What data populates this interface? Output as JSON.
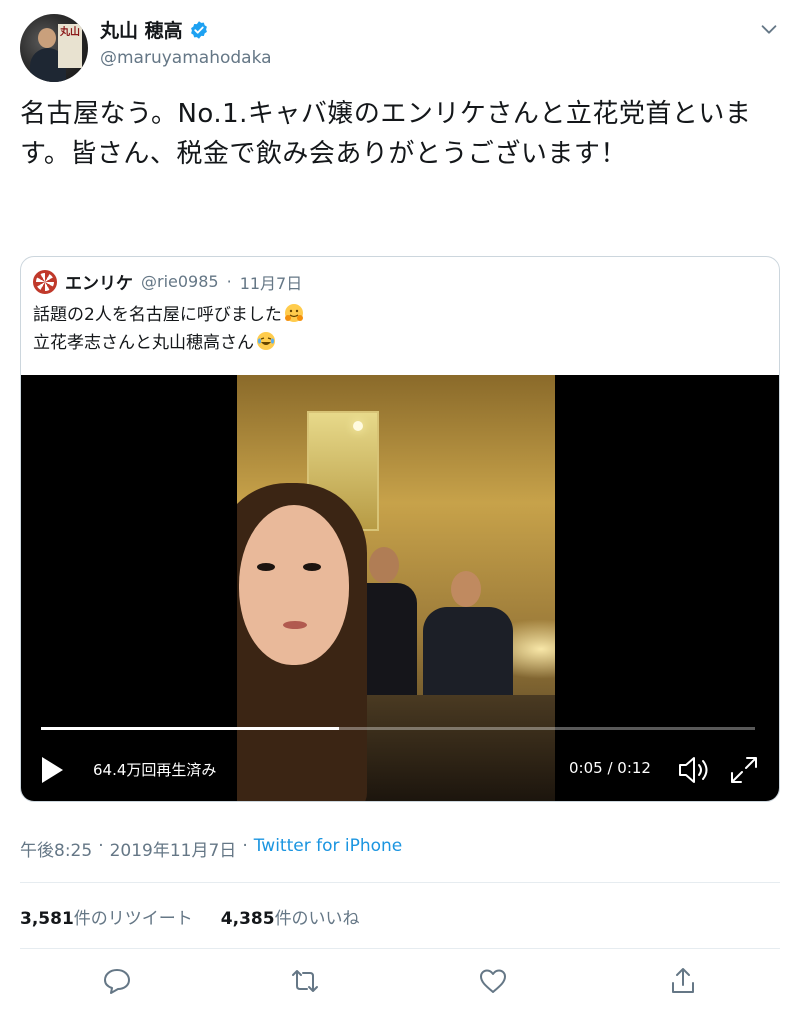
{
  "tweet": {
    "display_name": "丸山 穂高",
    "handle": "@maruyamahodaka",
    "avatar_badge": "丸山",
    "text": "名古屋なう。No.1.キャバ嬢のエンリケさんと立花党首といます。皆さん、税金で飲み会ありがとうございます！",
    "time": "午後8:25",
    "separator": "·",
    "date": "2019年11月7日",
    "source": "Twitter for iPhone"
  },
  "quote": {
    "name": "エンリケ",
    "handle": "@rie0985",
    "separator": "·",
    "date": "11月7日",
    "line1": "話題の2人を名古屋に呼びました",
    "line2": "立花孝志さんと丸山穂高さん"
  },
  "video": {
    "views": "64.4万回再生済み",
    "time": "0:05 / 0:12",
    "progress": 0.4167
  },
  "stats": {
    "retweets_count": "3,581",
    "retweets_label": "件のリツイート",
    "likes_count": "4,385",
    "likes_label": "件のいいね"
  },
  "colors": {
    "verified": "#1da1f2",
    "link": "#1b95e0",
    "secondary_text": "#657786",
    "icon": "#657786"
  }
}
